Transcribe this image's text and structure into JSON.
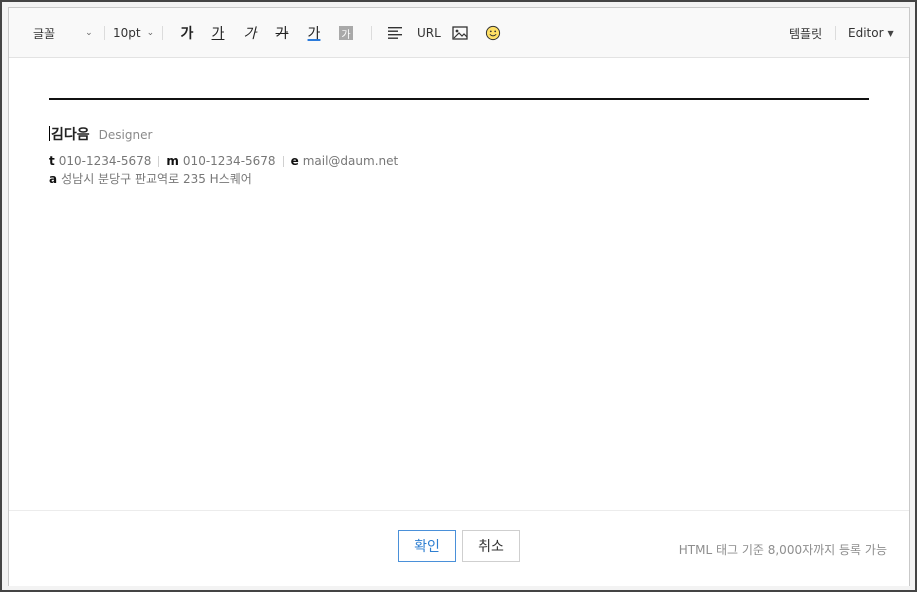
{
  "toolbar": {
    "font_select": "글꼴",
    "size_select": "10pt",
    "bold_label": "가",
    "underline_label": "가",
    "italic_label": "가",
    "strike_label": "가",
    "text_color_label": "가",
    "bg_color_label": "가",
    "url_label": "URL",
    "template_label": "템플릿",
    "editor_label": "Editor",
    "colors": {
      "text_color_underline": "#2b7bdc",
      "bg_color_box": "#a9a9a9"
    }
  },
  "signature": {
    "name": "김다음",
    "role": "Designer",
    "tel_key": "t",
    "tel_value": "010-1234-5678",
    "mobile_key": "m",
    "mobile_value": "010-1234-5678",
    "email_key": "e",
    "email_value": "mail@daum.net",
    "address_key": "a",
    "address_value": "성남시 분당구 판교역로 235 H스퀘어"
  },
  "footer": {
    "confirm_label": "확인",
    "cancel_label": "취소",
    "limit_note": "HTML 태그 기준 8,000자까지 등록 가능",
    "colors": {
      "confirm_border": "#4a90d9",
      "confirm_text": "#2f7fd1"
    }
  }
}
